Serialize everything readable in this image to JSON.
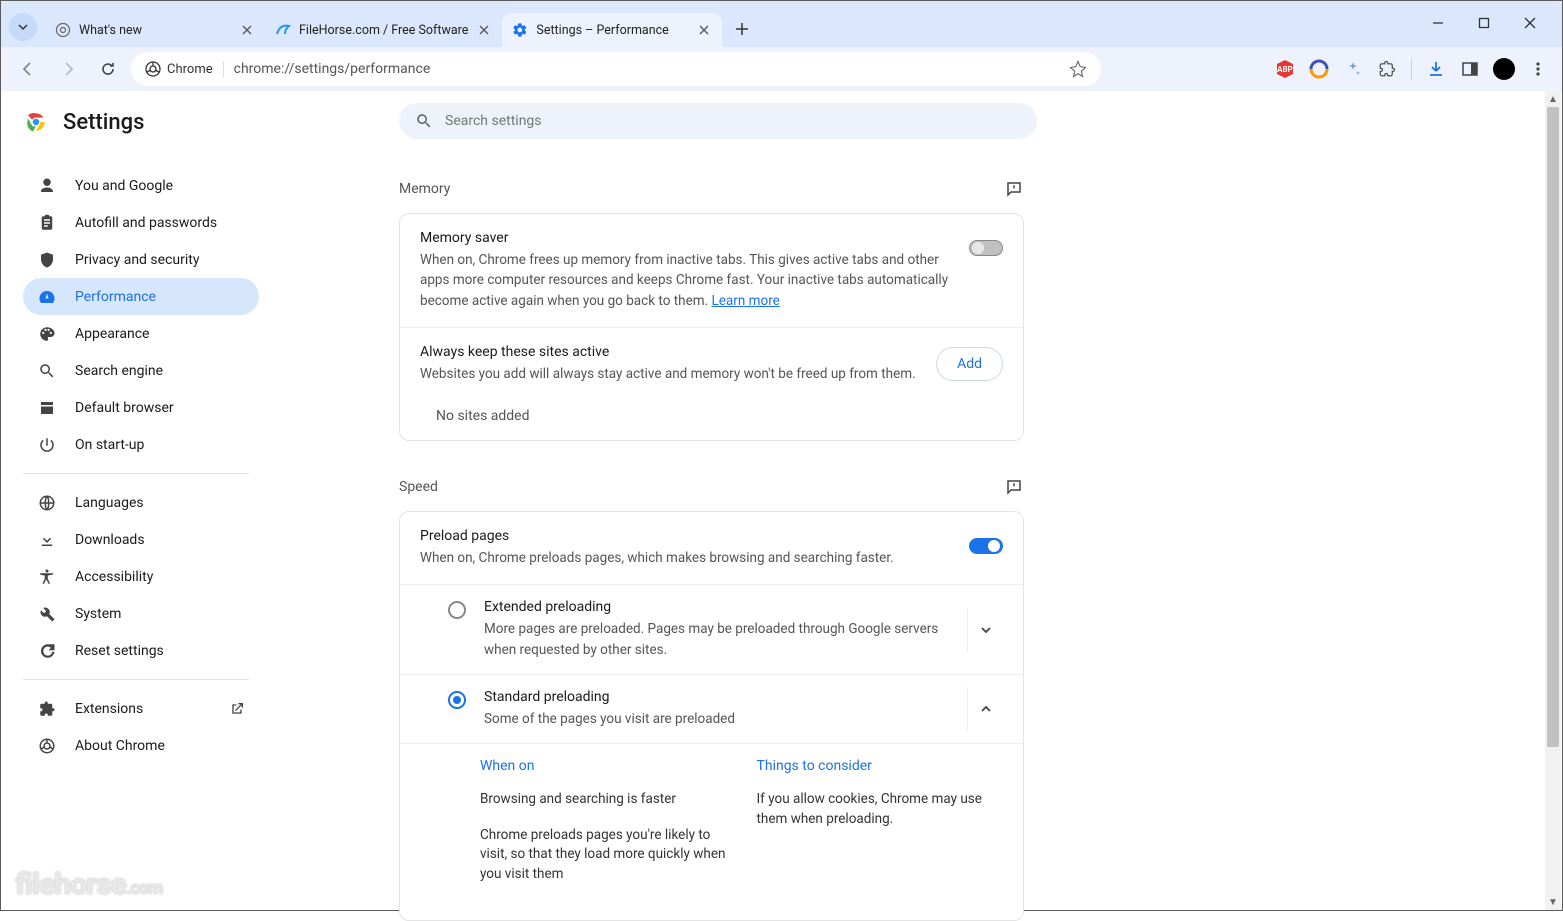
{
  "tabs": [
    {
      "title": "What's new"
    },
    {
      "title": "FileHorse.com / Free Software"
    },
    {
      "title": "Settings – Performance"
    }
  ],
  "omnibox": {
    "chip": "Chrome",
    "url": "chrome://settings/performance"
  },
  "brand": "Settings",
  "search": {
    "placeholder": "Search settings"
  },
  "nav": {
    "you": "You and Google",
    "autofill": "Autofill and passwords",
    "privacy": "Privacy and security",
    "performance": "Performance",
    "appearance": "Appearance",
    "search_engine": "Search engine",
    "default_browser": "Default browser",
    "startup": "On start-up",
    "languages": "Languages",
    "downloads": "Downloads",
    "accessibility": "Accessibility",
    "system": "System",
    "reset": "Reset settings",
    "extensions": "Extensions",
    "about": "About Chrome"
  },
  "sections": {
    "memory": "Memory",
    "speed": "Speed"
  },
  "memory_saver": {
    "title": "Memory saver",
    "desc_prefix": "When on, Chrome frees up memory from inactive tabs. This gives active tabs and other apps more computer resources and keeps Chrome fast. Your inactive tabs automatically become active again when you go back to them. ",
    "learn_more": "Learn more"
  },
  "keep_active": {
    "title": "Always keep these sites active",
    "desc": "Websites you add will always stay active and memory won't be freed up from them.",
    "add": "Add",
    "empty": "No sites added"
  },
  "preload": {
    "title": "Preload pages",
    "desc": "When on, Chrome preloads pages, which makes browsing and searching faster."
  },
  "preload_extended": {
    "title": "Extended preloading",
    "desc": "More pages are preloaded. Pages may be preloaded through Google servers when requested by other sites."
  },
  "preload_standard": {
    "title": "Standard preloading",
    "desc": "Some of the pages you visit are preloaded"
  },
  "detail": {
    "when_on": "When on",
    "when_on_1": "Browsing and searching is faster",
    "when_on_2": "Chrome preloads pages you're likely to visit, so that they load more quickly when you visit them",
    "consider": "Things to consider",
    "consider_1": "If you allow cookies, Chrome may use them when preloading."
  },
  "watermark": {
    "name": "filehorse",
    "dom": ".com"
  }
}
